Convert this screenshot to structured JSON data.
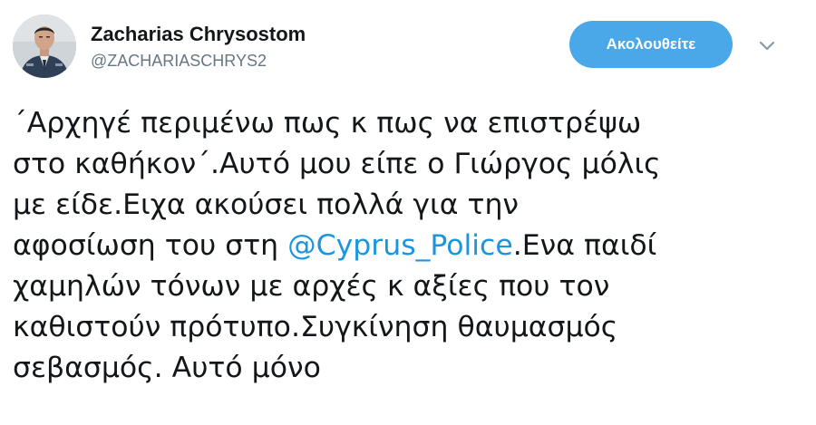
{
  "author": {
    "display_name": "Zacharias Chrysostom",
    "handle": "@ZACHARIASCHRYS2",
    "avatar_icon": "profile-photo"
  },
  "actions": {
    "follow_label": "Ακολουθείτε",
    "menu_icon": "chevron-down-icon"
  },
  "tweet": {
    "lines": [
      "΄Αρχηγέ περιμένω πως κ πως να επιστρέψω",
      "στο καθήκον΄.Αυτό μου είπε ο Γιώργος μόλις",
      "με είδε.Ειχα ακούσει πολλά για την"
    ],
    "line4_before": "αφοσίωση του στη ",
    "mention": "@Cyprus_Police",
    "line4_after": ".Ενα παιδί",
    "lines_end": [
      "χαμηλών τόνων με αρχές κ αξίες που τον",
      "καθιστούν πρότυπο.Συγκίνηση θαυμασμός",
      "σεβασμός. Αυτό μόνο"
    ]
  },
  "colors": {
    "follow_button_bg": "#4aa7e8",
    "mention": "#1b95e0",
    "handle": "#657786",
    "text": "#14171a"
  }
}
